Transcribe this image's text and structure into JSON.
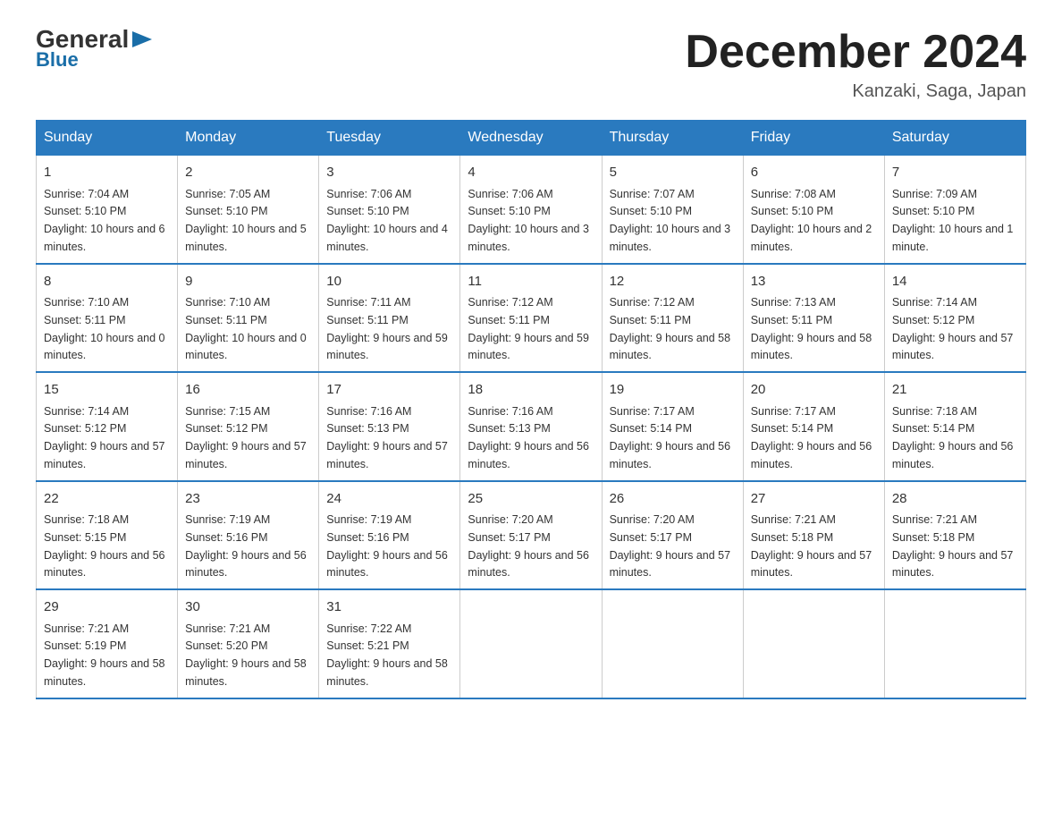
{
  "logo": {
    "general": "General",
    "triangle": "▶",
    "blue": "Blue"
  },
  "title": "December 2024",
  "subtitle": "Kanzaki, Saga, Japan",
  "days_of_week": [
    "Sunday",
    "Monday",
    "Tuesday",
    "Wednesday",
    "Thursday",
    "Friday",
    "Saturday"
  ],
  "weeks": [
    [
      {
        "day": "1",
        "sunrise": "7:04 AM",
        "sunset": "5:10 PM",
        "daylight": "10 hours and 6 minutes."
      },
      {
        "day": "2",
        "sunrise": "7:05 AM",
        "sunset": "5:10 PM",
        "daylight": "10 hours and 5 minutes."
      },
      {
        "day": "3",
        "sunrise": "7:06 AM",
        "sunset": "5:10 PM",
        "daylight": "10 hours and 4 minutes."
      },
      {
        "day": "4",
        "sunrise": "7:06 AM",
        "sunset": "5:10 PM",
        "daylight": "10 hours and 3 minutes."
      },
      {
        "day": "5",
        "sunrise": "7:07 AM",
        "sunset": "5:10 PM",
        "daylight": "10 hours and 3 minutes."
      },
      {
        "day": "6",
        "sunrise": "7:08 AM",
        "sunset": "5:10 PM",
        "daylight": "10 hours and 2 minutes."
      },
      {
        "day": "7",
        "sunrise": "7:09 AM",
        "sunset": "5:10 PM",
        "daylight": "10 hours and 1 minute."
      }
    ],
    [
      {
        "day": "8",
        "sunrise": "7:10 AM",
        "sunset": "5:11 PM",
        "daylight": "10 hours and 0 minutes."
      },
      {
        "day": "9",
        "sunrise": "7:10 AM",
        "sunset": "5:11 PM",
        "daylight": "10 hours and 0 minutes."
      },
      {
        "day": "10",
        "sunrise": "7:11 AM",
        "sunset": "5:11 PM",
        "daylight": "9 hours and 59 minutes."
      },
      {
        "day": "11",
        "sunrise": "7:12 AM",
        "sunset": "5:11 PM",
        "daylight": "9 hours and 59 minutes."
      },
      {
        "day": "12",
        "sunrise": "7:12 AM",
        "sunset": "5:11 PM",
        "daylight": "9 hours and 58 minutes."
      },
      {
        "day": "13",
        "sunrise": "7:13 AM",
        "sunset": "5:11 PM",
        "daylight": "9 hours and 58 minutes."
      },
      {
        "day": "14",
        "sunrise": "7:14 AM",
        "sunset": "5:12 PM",
        "daylight": "9 hours and 57 minutes."
      }
    ],
    [
      {
        "day": "15",
        "sunrise": "7:14 AM",
        "sunset": "5:12 PM",
        "daylight": "9 hours and 57 minutes."
      },
      {
        "day": "16",
        "sunrise": "7:15 AM",
        "sunset": "5:12 PM",
        "daylight": "9 hours and 57 minutes."
      },
      {
        "day": "17",
        "sunrise": "7:16 AM",
        "sunset": "5:13 PM",
        "daylight": "9 hours and 57 minutes."
      },
      {
        "day": "18",
        "sunrise": "7:16 AM",
        "sunset": "5:13 PM",
        "daylight": "9 hours and 56 minutes."
      },
      {
        "day": "19",
        "sunrise": "7:17 AM",
        "sunset": "5:14 PM",
        "daylight": "9 hours and 56 minutes."
      },
      {
        "day": "20",
        "sunrise": "7:17 AM",
        "sunset": "5:14 PM",
        "daylight": "9 hours and 56 minutes."
      },
      {
        "day": "21",
        "sunrise": "7:18 AM",
        "sunset": "5:14 PM",
        "daylight": "9 hours and 56 minutes."
      }
    ],
    [
      {
        "day": "22",
        "sunrise": "7:18 AM",
        "sunset": "5:15 PM",
        "daylight": "9 hours and 56 minutes."
      },
      {
        "day": "23",
        "sunrise": "7:19 AM",
        "sunset": "5:16 PM",
        "daylight": "9 hours and 56 minutes."
      },
      {
        "day": "24",
        "sunrise": "7:19 AM",
        "sunset": "5:16 PM",
        "daylight": "9 hours and 56 minutes."
      },
      {
        "day": "25",
        "sunrise": "7:20 AM",
        "sunset": "5:17 PM",
        "daylight": "9 hours and 56 minutes."
      },
      {
        "day": "26",
        "sunrise": "7:20 AM",
        "sunset": "5:17 PM",
        "daylight": "9 hours and 57 minutes."
      },
      {
        "day": "27",
        "sunrise": "7:21 AM",
        "sunset": "5:18 PM",
        "daylight": "9 hours and 57 minutes."
      },
      {
        "day": "28",
        "sunrise": "7:21 AM",
        "sunset": "5:18 PM",
        "daylight": "9 hours and 57 minutes."
      }
    ],
    [
      {
        "day": "29",
        "sunrise": "7:21 AM",
        "sunset": "5:19 PM",
        "daylight": "9 hours and 58 minutes."
      },
      {
        "day": "30",
        "sunrise": "7:21 AM",
        "sunset": "5:20 PM",
        "daylight": "9 hours and 58 minutes."
      },
      {
        "day": "31",
        "sunrise": "7:22 AM",
        "sunset": "5:21 PM",
        "daylight": "9 hours and 58 minutes."
      },
      null,
      null,
      null,
      null
    ]
  ]
}
